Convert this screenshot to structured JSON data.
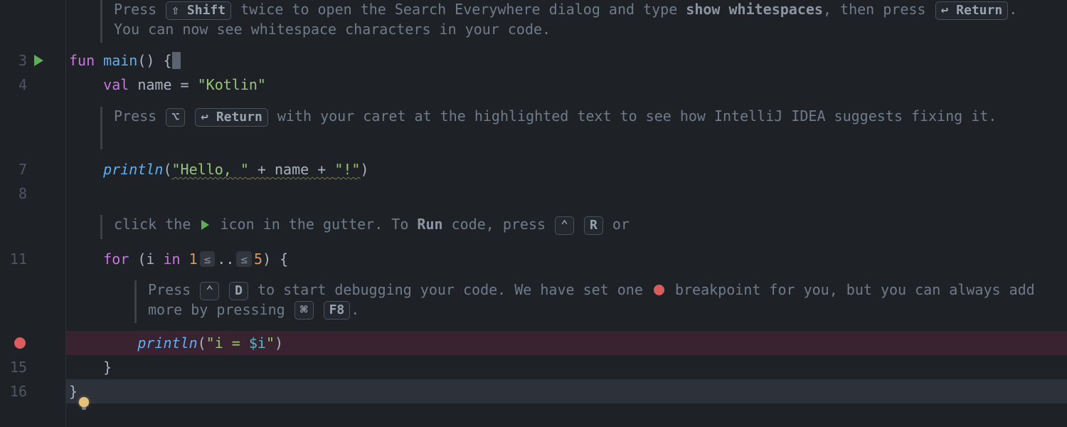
{
  "lines": {
    "n3": "3",
    "n4": "4",
    "n7": "7",
    "n8": "8",
    "n11": "11",
    "n15": "15",
    "n16": "16"
  },
  "hint1": {
    "press": "Press ",
    "k_shift": "⇧ Shift",
    "mid1": " twice to open the Search Everywhere dialog and type ",
    "bold1": "show whitespaces",
    "mid2": ", then press ",
    "k_return": "↩ Return",
    "tail": ". You can now see whitespace characters in your code."
  },
  "code3": {
    "fun": "fun ",
    "main": "main",
    "parens": "()",
    "sp": " ",
    "brace": "{"
  },
  "code4": {
    "indent": "    ",
    "val": "val ",
    "name": "name",
    "eq": " = ",
    "str": "\"Kotlin\""
  },
  "hint2": {
    "press": "Press ",
    "k_opt": "⌥",
    "k_return": "↩ Return",
    "mid": " with your caret at the highlighted text to see how IntelliJ IDEA suggests fixing it."
  },
  "code7": {
    "indent": "    ",
    "println": "println",
    "open": "(",
    "s1": "\"Hello, \"",
    "plus1": " + ",
    "nm": "name",
    "plus2": " + ",
    "s2": "\"!\"",
    "close": ")"
  },
  "hint3": {
    "t1": "click the ",
    "t2": " icon in the gutter. To ",
    "bold_run": "Run",
    "t3": " code, press ",
    "k_ctrl": "⌃",
    "k_r": "R",
    "t4": " or"
  },
  "code11": {
    "indent": "    ",
    "for": "for ",
    "open": "(",
    "i": "i",
    "in": " in ",
    "one": "1",
    "dots": "..",
    "le": "≤",
    "five": "5",
    "close": ")",
    "brace": " {"
  },
  "hint4": {
    "press": "Press ",
    "k_ctrl": "⌃",
    "k_d": "D",
    "mid1": " to start debugging your code. We have set one ",
    "mid2": " breakpoint for you, but you can always add more by pressing ",
    "k_cmd": "⌘",
    "k_f8": "F8",
    "tail": "."
  },
  "code14": {
    "indent": "        ",
    "println": "println",
    "open": "(",
    "q1": "\"",
    "txt": "i = ",
    "tmpl": "$i",
    "q2": "\"",
    "close": ")"
  },
  "code15": {
    "indent": "    ",
    "brace": "}"
  },
  "code16": {
    "brace": "}"
  }
}
